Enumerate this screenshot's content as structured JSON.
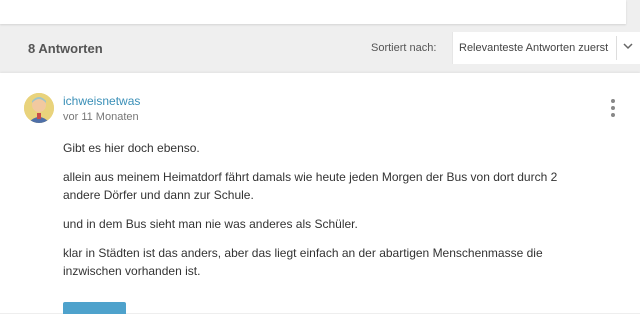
{
  "header": {
    "answers_count": "8 Antworten",
    "sort_label": "Sortiert nach:",
    "sort_value": "Relevanteste Antworten zuerst"
  },
  "answer": {
    "username": "ichweisnetwas",
    "timestamp": "vor 11 Monaten",
    "paragraphs": [
      "Gibt es hier doch ebenso.",
      "allein aus meinem Heimatdorf fährt damals wie heute jeden Morgen der Bus von dort durch 2 andere Dörfer und dann zur Schule.",
      "und in dem Bus sieht man nie was anderes als Schüler.",
      "klar in Städten ist das anders, aber das liegt einfach an der abartigen Menschenmasse die inzwischen vorhanden ist."
    ]
  },
  "icons": {
    "more": "more-vertical-icon",
    "chevron": "chevron-down-icon"
  },
  "colors": {
    "accent": "#3a8fb7",
    "button": "#4ea2cc",
    "background": "#efefef"
  }
}
